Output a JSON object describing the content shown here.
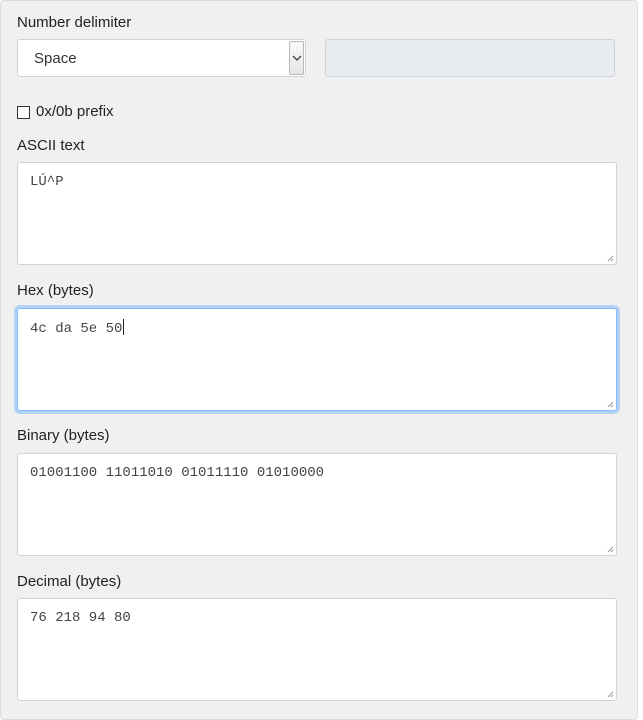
{
  "delimiter": {
    "label": "Number delimiter",
    "selected": "Space",
    "custom_value": ""
  },
  "prefix": {
    "label": "0x/0b prefix",
    "checked": false
  },
  "fields": [
    {
      "label": "ASCII text",
      "value": "LÚ^P",
      "focused": false
    },
    {
      "label": "Hex (bytes)",
      "value": "4c da 5e 50",
      "focused": true
    },
    {
      "label": "Binary (bytes)",
      "value": "01001100 11011010 01011110 01010000",
      "focused": false
    },
    {
      "label": "Decimal (bytes)",
      "value": "76 218 94 80",
      "focused": false
    }
  ],
  "colors": {
    "panel_bg": "#f0f0f0",
    "focus_border": "#80bdff",
    "readonly_bg": "#e9ecef"
  },
  "icons": {
    "select_arrow": "chevron-down-icon",
    "resize": "resize-grip-icon"
  }
}
